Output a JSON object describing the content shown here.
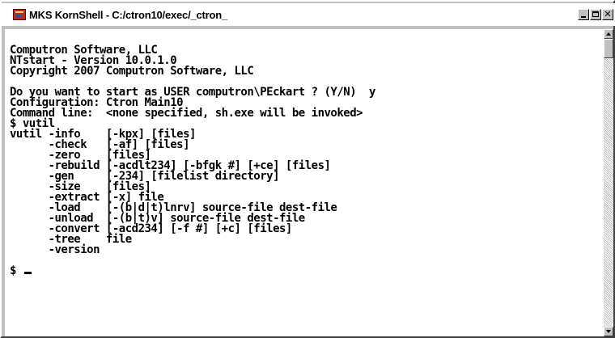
{
  "window": {
    "title": "MKS KornShell - C:/ctron10/exec/_ctron_",
    "icon": "kornshell-app-icon",
    "buttons": {
      "minimize": "minimize-icon",
      "maximize": "maximize-icon",
      "close": "close-icon",
      "close_label": "✕"
    }
  },
  "console": {
    "lines": [
      "Computron Software, LLC",
      "NTstart - Version 10.0.1.0",
      "Copyright 2007 Computron Software, LLC",
      "",
      "Do you want to start as USER computron\\PEckart ? (Y/N)  y",
      "Configuration: Ctron Main10",
      "Command line:  <none specified, sh.exe will be invoked>",
      "$ vutil",
      "vutil -info    [-kpx] [files]",
      "      -check   [-af] [files]",
      "      -zero    [files]",
      "      -rebuild [-acdlt234] [-bfgk #] [+ce] [files]",
      "      -gen     [-234] [filelist directory]",
      "      -size    [files]",
      "      -extract [-x] file",
      "      -load    [-(b|d|t)lnrv] source-file dest-file",
      "      -unload  [-(b|t)v] source-file dest-file",
      "      -convert [-acd234] [-f #] [+c] [files]",
      "      -tree    file",
      "      -version",
      ""
    ],
    "prompt": "$ "
  },
  "colors": {
    "console_bg": "#ffffff",
    "console_fg": "#000000",
    "chrome": "#c0c0c0"
  }
}
